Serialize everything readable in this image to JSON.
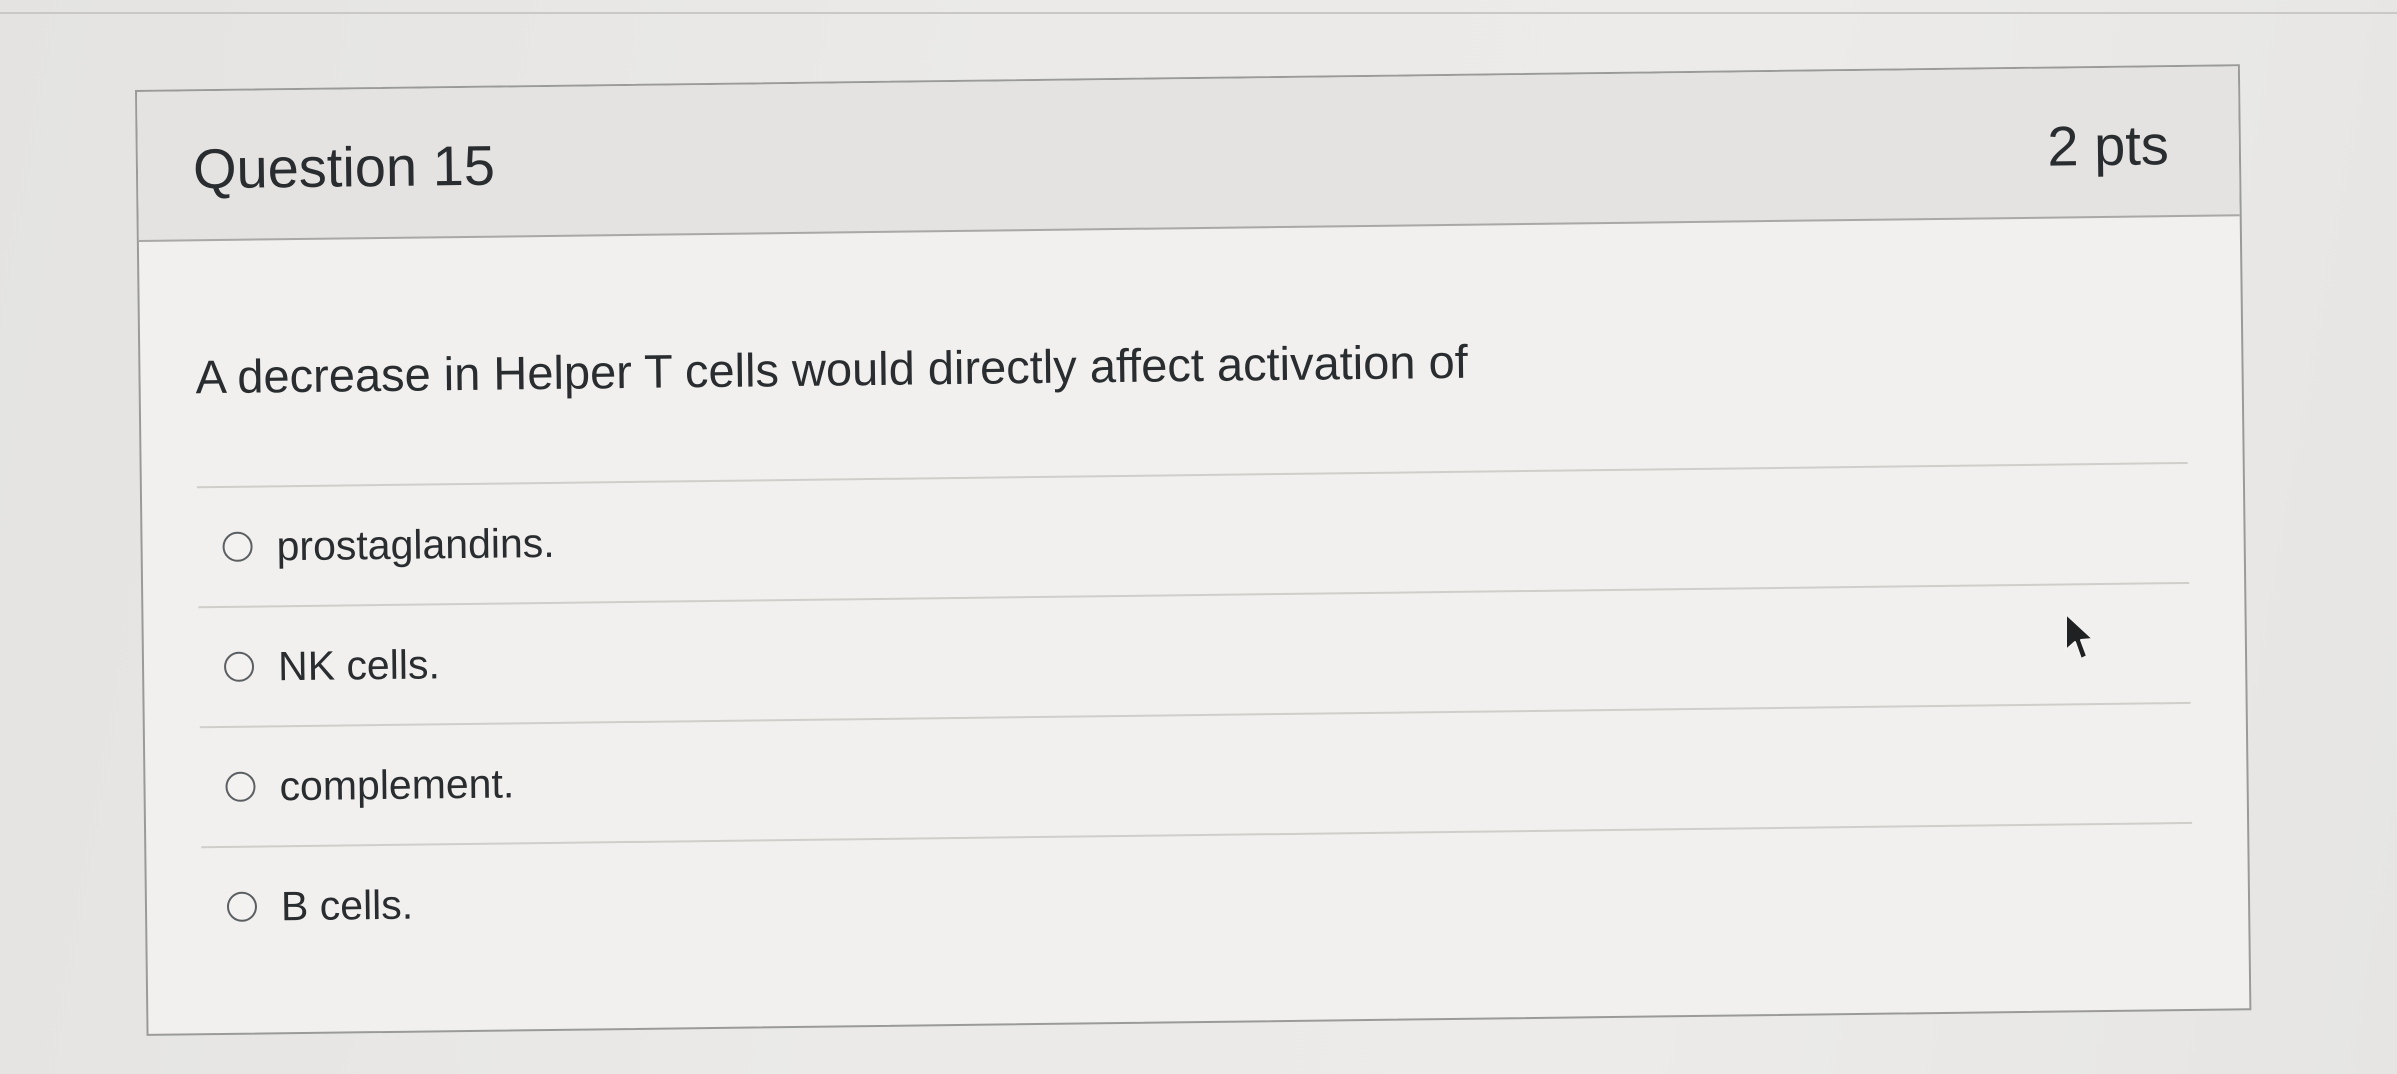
{
  "question": {
    "title": "Question 15",
    "points": "2 pts",
    "text": "A decrease in Helper T cells would directly affect activation of"
  },
  "answers": [
    {
      "label": "prostaglandins.",
      "selected": false
    },
    {
      "label": "NK cells.",
      "selected": false
    },
    {
      "label": "complement.",
      "selected": false
    },
    {
      "label": "B cells.",
      "selected": false
    }
  ],
  "icons": {
    "answer_radio": "radio-empty-icon",
    "pointer": "mouse-cursor-icon"
  },
  "colors": {
    "text": "#2a2d30",
    "header_background": "#e4e3e1",
    "card_border": "#9a9a98"
  }
}
